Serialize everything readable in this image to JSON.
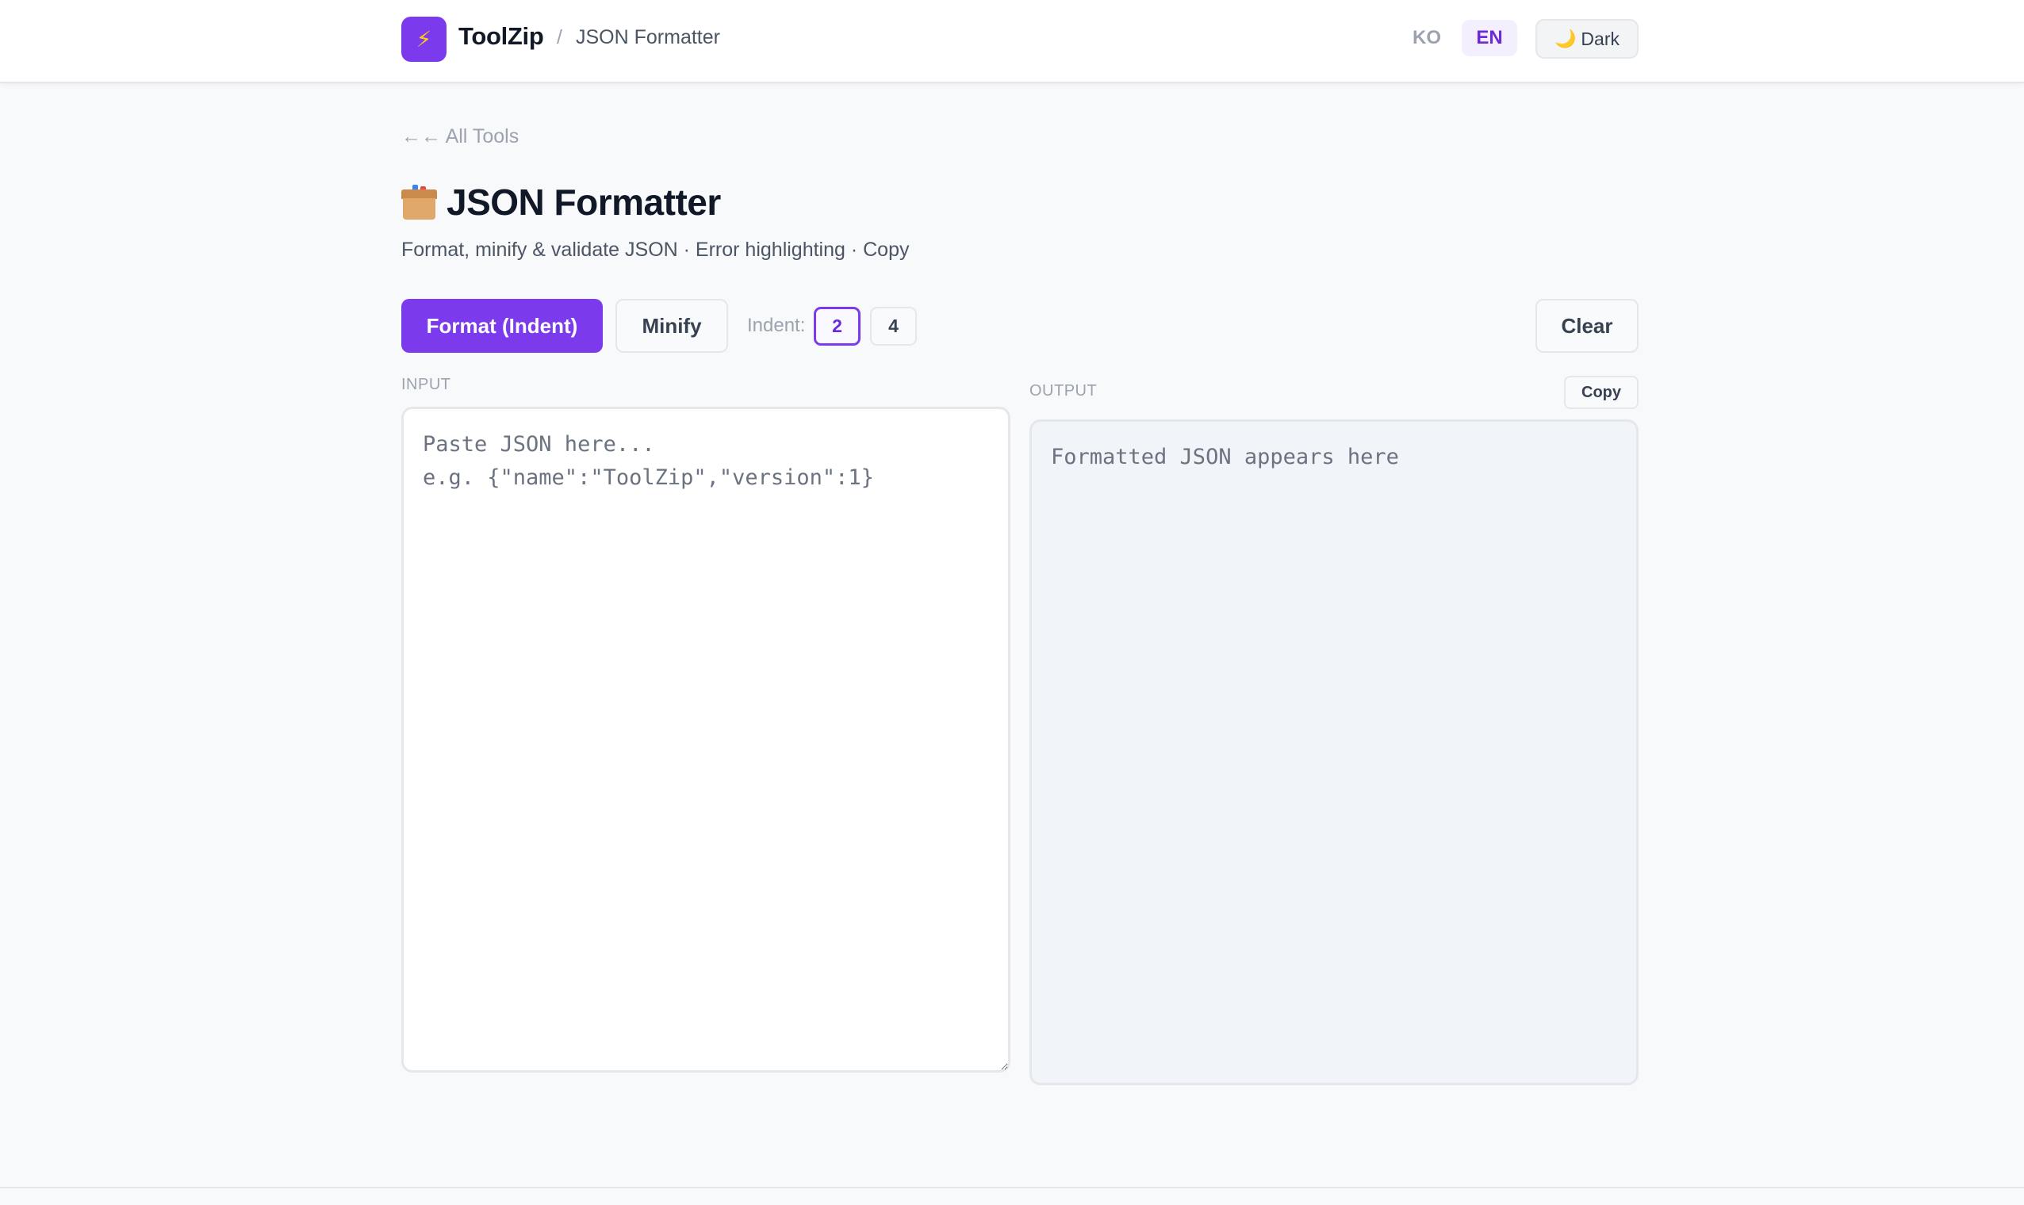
{
  "header": {
    "brand": "ToolZip",
    "logo_icon": "lightning-icon",
    "separator": "/",
    "current_page": "JSON Formatter",
    "lang_ko": "KO",
    "lang_en": "EN",
    "active_lang": "EN",
    "theme_label": "Dark",
    "theme_icon": "moon-icon"
  },
  "page": {
    "back_label": "←← All Tools",
    "title": "JSON Formatter",
    "title_icon": "card-file-box-icon",
    "subtitle": "Format, minify & validate JSON · Error highlighting · Copy"
  },
  "toolbar": {
    "format_label": "Format (Indent)",
    "minify_label": "Minify",
    "indent_label": "Indent:",
    "indent_options": [
      "2",
      "4"
    ],
    "indent_selected": "2",
    "clear_label": "Clear"
  },
  "input": {
    "label": "INPUT",
    "value": "",
    "placeholder": "Paste JSON here...\ne.g. {\"name\":\"ToolZip\",\"version\":1}"
  },
  "output": {
    "label": "OUTPUT",
    "copy_label": "Copy",
    "placeholder": "Formatted JSON appears here"
  },
  "colors": {
    "accent": "#7c3aed",
    "accent_text": "#6d28d9",
    "background": "#f8f9fb"
  }
}
